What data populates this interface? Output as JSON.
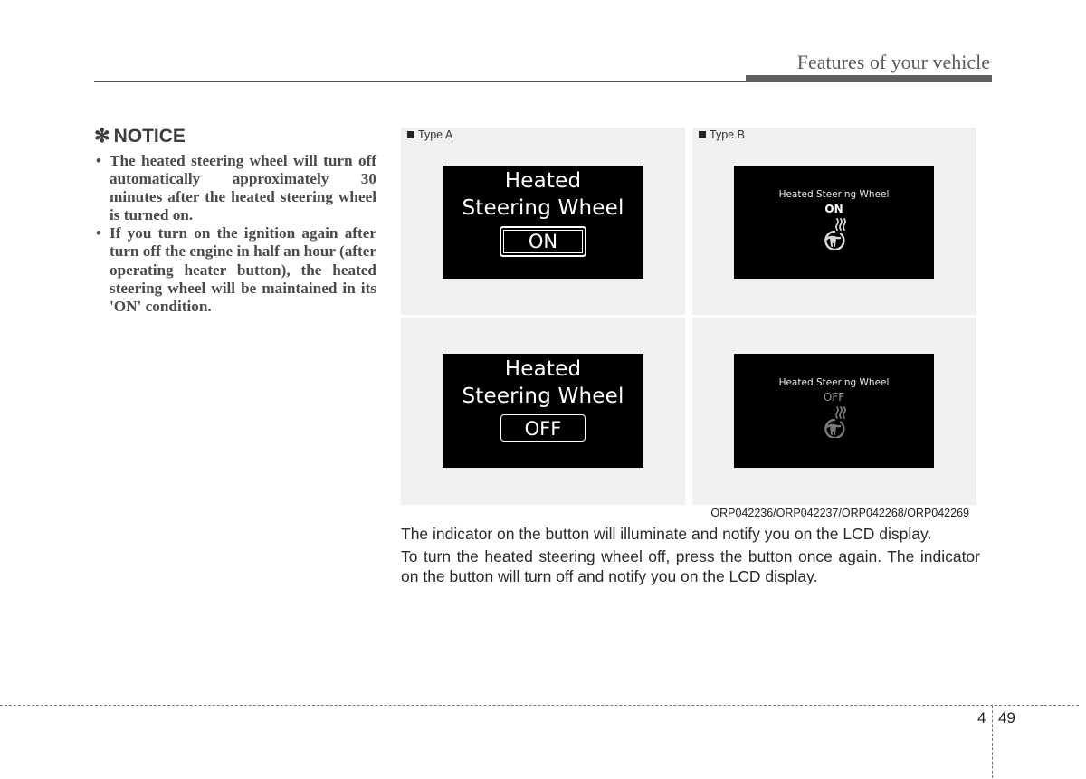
{
  "header": {
    "section_title": "Features of your vehicle"
  },
  "notice": {
    "icon": "asterisk-icon",
    "icon_glyph": "✻",
    "title": "NOTICE",
    "items": [
      "The heated steering wheel will turn off automatically approximately 30 minutes after the heated steering wheel is turned on.",
      "If you turn on the ignition again after turn off the engine in half an hour (after operating heater button), the heated steering wheel will be maintained in its 'ON' condition."
    ],
    "bullet": "•"
  },
  "figure": {
    "type_a": {
      "label": "Type A",
      "on": {
        "title_line1": "Heated",
        "title_line2": "Steering Wheel",
        "state": "ON"
      },
      "off": {
        "title_line1": "Heated",
        "title_line2": "Steering Wheel",
        "state": "OFF"
      }
    },
    "type_b": {
      "label": "Type B",
      "on": {
        "title": "Heated Steering Wheel",
        "state": "ON",
        "icon": "heated-steering-wheel-icon"
      },
      "off": {
        "title": "Heated Steering Wheel",
        "state": "OFF",
        "icon": "heated-steering-wheel-icon"
      }
    },
    "code": "ORP042236/ORP042237/ORP042268/ORP042269",
    "colors": {
      "lcd_bg": "#000000",
      "panel_bg": "#f0f0f0",
      "on_icon": "#d8d8d8",
      "off_icon": "#7a7a7a"
    }
  },
  "body": {
    "para1": "The indicator on the button will illuminate and notify you on the LCD display.",
    "para2": "To turn the heated steering wheel off, press the button once again. The indicator on the button will turn off and notify you on the LCD display."
  },
  "footer": {
    "chapter": "4",
    "page": "49"
  }
}
